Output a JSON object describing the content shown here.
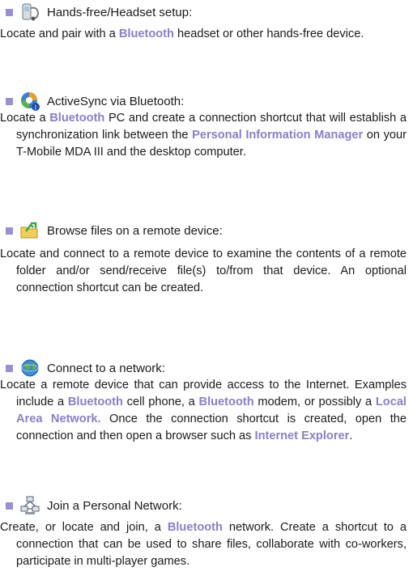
{
  "sections": [
    {
      "title": "Hands-free/Headset setup:",
      "icon": "headset-icon",
      "text": [
        {
          "t": "Locate and pair with a "
        },
        {
          "t": "Bluetooth",
          "kw": true
        },
        {
          "t": " headset or other hands-free device."
        }
      ]
    },
    {
      "title": "ActiveSync via Bluetooth:",
      "icon": "activesync-icon",
      "text": [
        {
          "t": "Locate a "
        },
        {
          "t": "Bluetooth",
          "kw": true
        },
        {
          "t": " PC and create a connection shortcut that will establish a synchronization link between the "
        },
        {
          "t": "Personal Information Manager",
          "kw": true
        },
        {
          "t": " on your T-Mobile MDA III and the desktop computer."
        }
      ]
    },
    {
      "title": "Browse files on a remote device:",
      "icon": "folder-icon",
      "text": [
        {
          "t": "Locate and connect to a remote device to examine the contents of a remote folder and/or send/receive file(s) to/from that device. An optional connection shortcut can be created."
        }
      ]
    },
    {
      "title": "Connect to a network:",
      "icon": "globe-icon",
      "text": [
        {
          "t": "Locate a remote device that can provide access to the Internet. Examples include a "
        },
        {
          "t": "Bluetooth",
          "kw": true
        },
        {
          "t": " cell phone, a "
        },
        {
          "t": "Bluetooth",
          "kw": true
        },
        {
          "t": " modem, or possibly a "
        },
        {
          "t": "Local Area Network.",
          "kw": true
        },
        {
          "t": " Once the connection shortcut is created, open the connection and then open a browser such as "
        },
        {
          "t": "Internet Explorer",
          "kw": true
        },
        {
          "t": "."
        }
      ]
    },
    {
      "title": "Join a Personal Network:",
      "icon": "network-icon",
      "text": [
        {
          "t": "Create, or locate and join, a "
        },
        {
          "t": "Bluetooth",
          "kw": true
        },
        {
          "t": " network. Create a shortcut to a connection that can be used to share files, collaborate with co-workers, participate in multi-player games."
        }
      ]
    }
  ],
  "colors": {
    "bullet": "#9b8fd3",
    "keyword": "#8b7fc6",
    "text": "#1a1a1a"
  }
}
